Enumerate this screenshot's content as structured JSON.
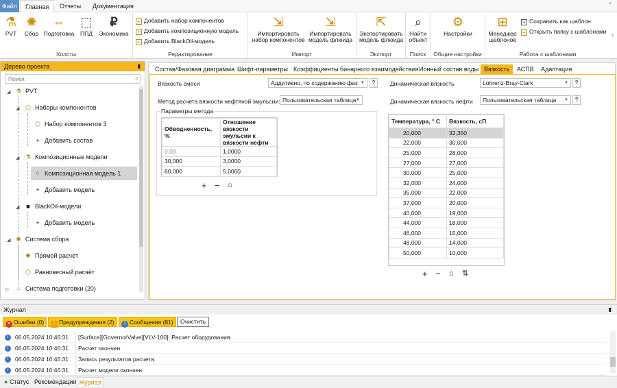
{
  "menu": {
    "file": "Файл",
    "tabs": [
      "Главная",
      "Отчеты",
      "Документация"
    ]
  },
  "ribbon": {
    "buttons": [
      {
        "label": "PVT",
        "icon": "pvt-icon"
      },
      {
        "label": "Сбор",
        "icon": "gathering-icon"
      },
      {
        "label": "Подготовка",
        "icon": "preparation-icon"
      },
      {
        "label": "ППД",
        "icon": "ppd-icon"
      },
      {
        "label": "Экономика",
        "icon": "economics-icon"
      }
    ],
    "group_holsty": "Холсты",
    "edit_items": [
      "Добавить набор компонентов",
      "Добавить композиционную модель",
      "Добавить BlackOil-модель"
    ],
    "group_edit": "Редактирование",
    "import_buttons": [
      "Импортировать набор компонентов",
      "Импортировать модель флюида"
    ],
    "group_import": "Импорт",
    "export_button": "Экспортировать модель флюида",
    "group_export": "Экспорт",
    "find_button": "Найти объект",
    "group_find": "Поиск",
    "settings_button": "Настройки",
    "group_settings": "Общие настройки",
    "template_manager": "Менеджер шаблонов",
    "template_items": [
      "Сохранить как шаблон",
      "Открыть папку с шаблонами"
    ],
    "group_templates": "Работа с шаблонами"
  },
  "tree": {
    "title": "Дерево проекта",
    "search_placeholder": "Поиск",
    "nodes": [
      {
        "label": "PVT"
      },
      {
        "label": "Наборы компонентов"
      },
      {
        "label": "Набор компонентов 3"
      },
      {
        "label": "Добавить состав"
      },
      {
        "label": "Композиционные модели"
      },
      {
        "label": "Композиционная модель 1"
      },
      {
        "label": "Добавить модель"
      },
      {
        "label": "BlackOil-модели"
      },
      {
        "label": "Добавить модель"
      },
      {
        "label": "Система сбора"
      },
      {
        "label": "Прямой расчёт"
      },
      {
        "label": "Равновесный расчёт"
      },
      {
        "label": "Система подготовки (20)"
      }
    ]
  },
  "tabs": [
    "Состав/Фазовая диаграмма",
    "Шифт-параметры",
    "Коэффициенты бинарного взаимодействия",
    "Ионный состав воды",
    "Вязкость",
    "АСПВ",
    "Адаптация"
  ],
  "viscosity": {
    "mix_label": "Вязкость смеси",
    "mix_value": "Аддитивно, по содержанию фаз",
    "emulsion_label": "Метод расчета вязкости нефтяной эмульсии:",
    "emulsion_value": "Пользовательская таблица",
    "params_title": "Параметры метода",
    "params_headers": [
      "Обводненность, %",
      "Отношение вязкости эмульсии к вязкости нефти"
    ],
    "params_rows": [
      [
        "0,00",
        "1,0000"
      ],
      [
        "30,000",
        "3,0000"
      ],
      [
        "60,000",
        "5,0000"
      ]
    ],
    "dyn_label": "Динамическая вязкость",
    "dyn_value": "Lohrenz-Bray-Clark",
    "dyn_oil_label": "Динамическая вязкость нефти",
    "dyn_oil_value": "Пользовательская таблица",
    "temp_headers": [
      "Температура, ° С",
      "Вязкость, сП"
    ],
    "temp_rows": [
      [
        "20,000",
        "32,350"
      ],
      [
        "22,000",
        "30,000"
      ],
      [
        "25,000",
        "28,000"
      ],
      [
        "27,000",
        "27,000"
      ],
      [
        "30,000",
        "25,000"
      ],
      [
        "32,000",
        "24,000"
      ],
      [
        "35,000",
        "22,000"
      ],
      [
        "37,000",
        "20,000"
      ],
      [
        "40,000",
        "19,000"
      ],
      [
        "44,000",
        "18,000"
      ],
      [
        "46,000",
        "15,000"
      ],
      [
        "48,000",
        "14,000"
      ],
      [
        "50,000",
        "10,000"
      ]
    ],
    "help": "?"
  },
  "journal": {
    "title": "Журнал",
    "errors": "Ошибки (0)",
    "warnings": "Предупреждения (2)",
    "messages": "Сообщения (81)",
    "clear": "Очистить",
    "rows": [
      {
        "time": "06.05.2024 10:46:31",
        "msg": "[Surface][GovernorValve][VLV-100]: Расчет оборудования."
      },
      {
        "time": "06.05.2024 10:46:31",
        "msg": "Расчет окончен."
      },
      {
        "time": "06.05.2024 10:46:31",
        "msg": "Запись результатов расчета."
      },
      {
        "time": "06.05.2024 10:46:31",
        "msg": "Расчет модели окончен."
      }
    ]
  },
  "status": {
    "tabs": [
      "Статус",
      "Рекомендации",
      "Журнал"
    ]
  }
}
